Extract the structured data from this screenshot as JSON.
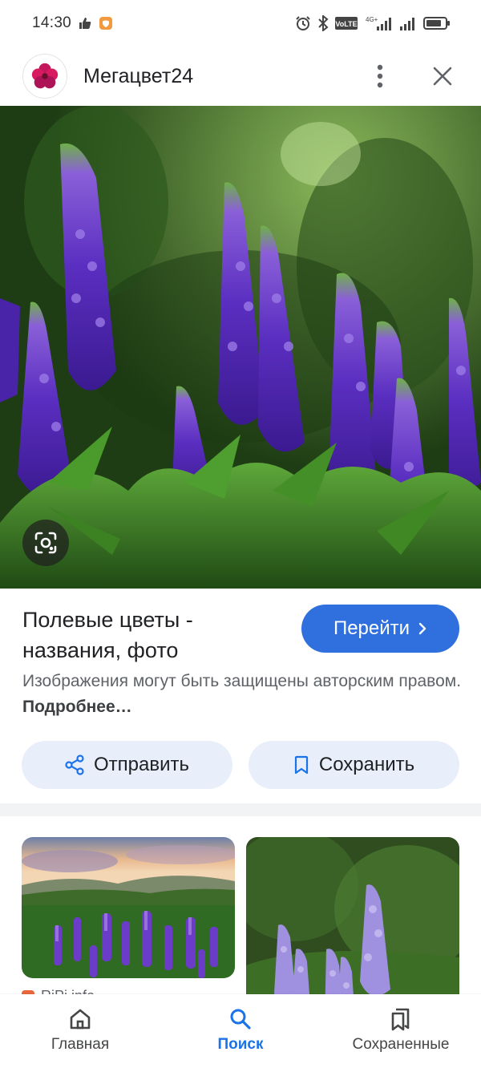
{
  "status_bar": {
    "time": "14:30",
    "network": "4G+",
    "volte": "VoLTE"
  },
  "header": {
    "site_name": "Мегацвет24",
    "more_label": "more options",
    "close_label": "close"
  },
  "result": {
    "title": "Полевые цветы - названия, фото",
    "visit_label": "Перейти",
    "copyright_text": "Изображения могут быть защищены авторским правом.",
    "more_link": "Подробнее…",
    "share_label": "Отправить",
    "save_label": "Сохранить"
  },
  "related": {
    "source_1": "RiPi.info"
  },
  "bottom_nav": {
    "items": [
      {
        "label": "Главная",
        "icon": "home-icon"
      },
      {
        "label": "Поиск",
        "icon": "search-icon",
        "active": true
      },
      {
        "label": "Сохраненные",
        "icon": "saved-icon"
      }
    ]
  },
  "colors": {
    "accent": "#2f6fde",
    "chip_bg": "#e8effb",
    "active_nav": "#1a73e8"
  }
}
